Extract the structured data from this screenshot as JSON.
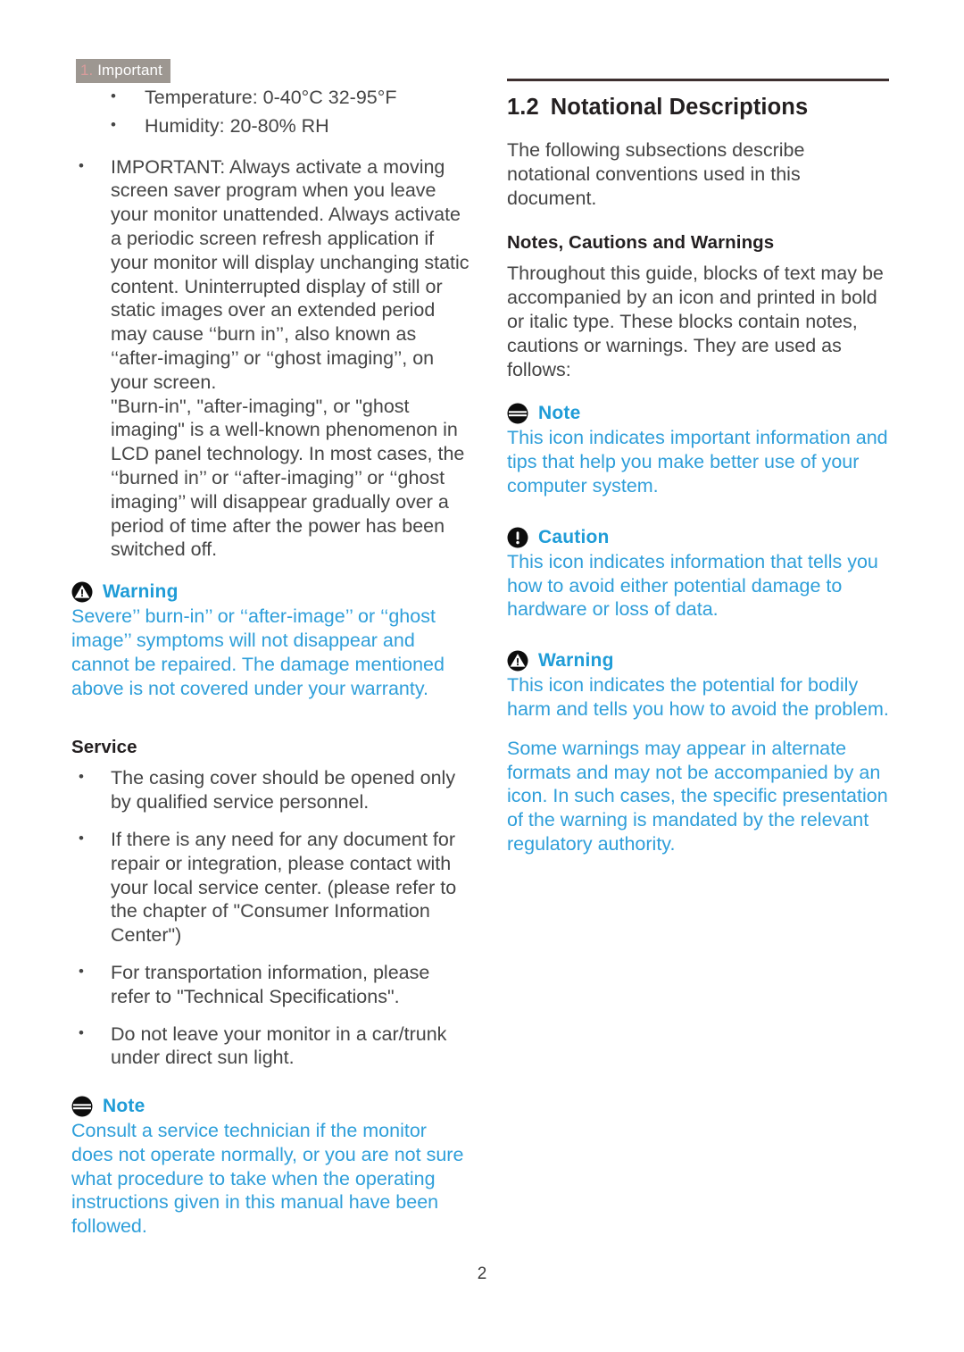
{
  "header": {
    "section_number": "1.",
    "section_name": "Important"
  },
  "left_column": {
    "env_bullets": [
      "Temperature: 0-40°C 32-95°F",
      "Humidity: 20-80% RH"
    ],
    "important_bullet": "IMPORTANT: Always activate a moving screen saver program when you leave your monitor unattended. Always activate a periodic screen refresh application if your monitor will display unchanging static content. Uninterrupted display of still or static images over an extended period may cause ‘‘burn in’’, also known as ‘‘after-imaging’’ or ‘‘ghost imaging’’, on your screen.",
    "burn_in_paragraph": "\"Burn-in\", \"after-imaging\", or \"ghost imaging\" is a well-known phenomenon in LCD panel technology. In most cases, the ‘‘burned in’’ or ‘‘after-imaging’’ or ‘‘ghost imaging’’ will disappear gradually over a period of time after the power has been switched off.",
    "warning_callout": {
      "icon": "warning-triangle-icon",
      "title": "Warning",
      "body": "Severe’’ burn-in’’ or ‘‘after-image’’ or ‘‘ghost image’’ symptoms will not disappear and cannot be repaired. The damage mentioned above is not covered under your warranty."
    },
    "service_heading": "Service",
    "service_bullets": [
      "The casing cover should be opened only by qualified service personnel.",
      "If there is any need for any document for repair or integration, please contact with your local service center. (please refer to the chapter of \"Consumer Information Center\")",
      "For transportation information, please refer to \"Technical Specifications\".",
      "Do not leave your monitor in a car/trunk under direct sun light."
    ],
    "note_callout": {
      "icon": "note-lines-icon",
      "title": "Note",
      "body": "Consult a service technician if the monitor does not operate normally, or you are not sure what procedure to take when the operating instructions given in this manual have been followed."
    }
  },
  "right_column": {
    "section_number": "1.2",
    "section_title": "Notational Descriptions",
    "intro": "The following subsections describe notational conventions used in this document.",
    "sub_heading": "Notes, Cautions and Warnings",
    "sub_intro": "Throughout this guide, blocks of text may be accompanied by an icon and printed in bold or italic type. These blocks contain notes, cautions or warnings. They are used as follows:",
    "note_callout": {
      "icon": "note-lines-icon",
      "title": "Note",
      "body": "This icon indicates important information and tips that help you make better use of your computer system."
    },
    "caution_callout": {
      "icon": "caution-exclamation-icon",
      "title": "Caution",
      "body": "This icon indicates information that tells you how to avoid either potential damage to hardware or loss of data."
    },
    "warning_callout": {
      "icon": "warning-triangle-icon",
      "title": "Warning",
      "body": "This icon indicates the potential for bodily harm and tells you how to avoid the problem.",
      "body2": "Some warnings may appear in alternate formats and may not be accompanied by an icon. In such cases, the specific presentation of the warning is mandated by the relevant regulatory authority."
    }
  },
  "footer": {
    "page_number": "2"
  },
  "colors": {
    "callout_blue": "#2f9fda",
    "callout_title_blue": "#1f9cd7",
    "header_bg_gray": "#9d9791",
    "header_num_pink": "#d99b9b",
    "rule_dark": "#3d2f2f",
    "body_text": "#454545"
  }
}
